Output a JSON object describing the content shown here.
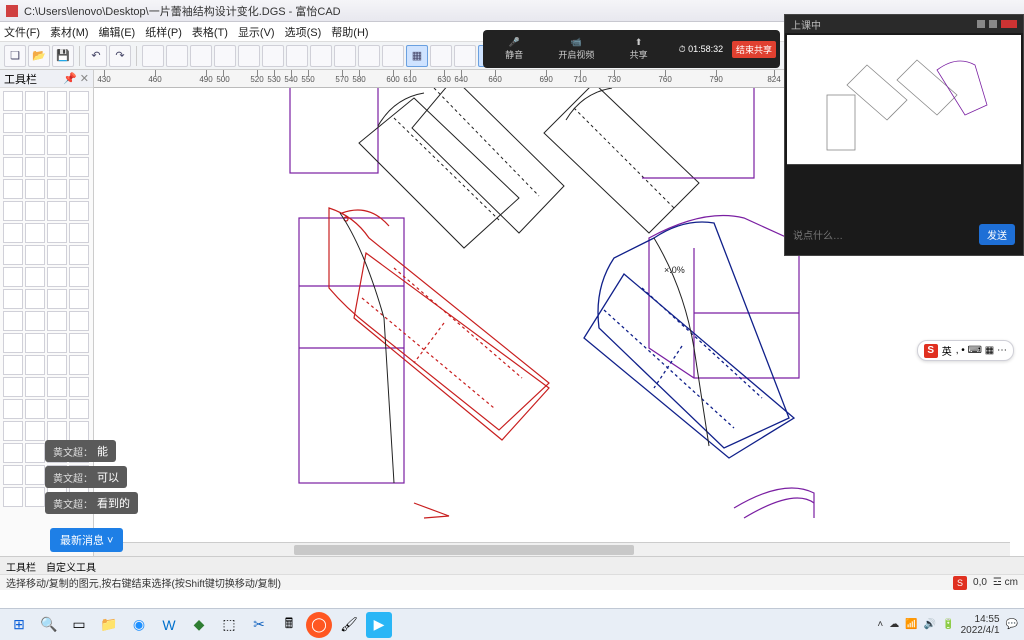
{
  "window": {
    "title": "C:\\Users\\lenovo\\Desktop\\一片蕾袖结构设计变化.DGS - 富怡CAD"
  },
  "menu": {
    "file": "文件(F)",
    "material": "素材(M)",
    "edit": "编辑(E)",
    "pattern": "纸样(P)",
    "table": "表格(T)",
    "display": "显示(V)",
    "options": "选项(S)",
    "help": "帮助(H)"
  },
  "toolbox": {
    "header": "工具栏"
  },
  "ruler": {
    "ticks": [
      430,
      460,
      490,
      500,
      520,
      530,
      540,
      550,
      570,
      580,
      600,
      610,
      630,
      640,
      660,
      690,
      710,
      730,
      760,
      790,
      824
    ]
  },
  "canvas": {
    "annotation": "×.0%"
  },
  "conference": {
    "audio": "静音",
    "video": "开启视频",
    "screen": "共享",
    "end": "结束共享",
    "timer": "01:58:32"
  },
  "mini": {
    "title": "上课中",
    "chat_placeholder": "说点什么…",
    "send": "发送"
  },
  "chat": {
    "user": "黄文超：",
    "m1": "能",
    "m2": "可以",
    "m3": "看到的",
    "new_msg": "最新消息 ˅"
  },
  "ime": {
    "logo": "S",
    "label": "英",
    "icons": ", • ⌨ ▦ ⋯"
  },
  "status_tabs": {
    "t1": "工具栏",
    "t2": "自定义工具"
  },
  "status": {
    "hint": "选择移动/复制的图元,按右键结束选择(按Shift键切换移动/复制)",
    "coords": "0,0",
    "unit": "☲ cm"
  },
  "clock": {
    "time": "14:55",
    "date": "2022/4/1"
  },
  "colors": {
    "title_accent": "#d04040",
    "toolbar_sel": "#cfe3ff"
  },
  "chart_data": null
}
